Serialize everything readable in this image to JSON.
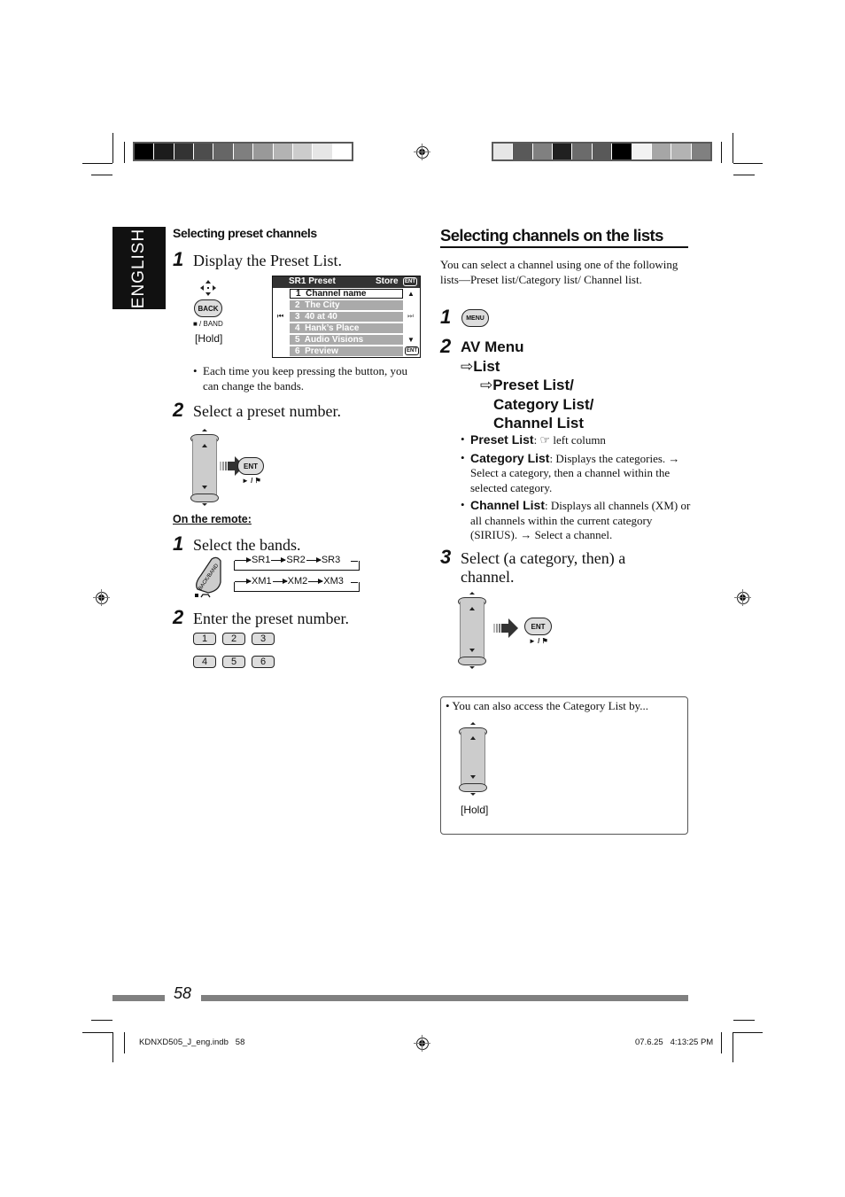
{
  "print_marks": {
    "color_bar_left": [
      "#000000",
      "#1c1c1c",
      "#333333",
      "#4d4d4d",
      "#666666",
      "#7f7f7f",
      "#999999",
      "#b3b3b3",
      "#cccccc",
      "#e6e6e6",
      "#ffffff"
    ],
    "color_bar_right": [
      "#e6e6e6",
      "#595959",
      "#808080",
      "#202020",
      "#6b6b6b",
      "#595959",
      "#000000",
      "#f2f2f2",
      "#a6a6a6",
      "#b3b3b3",
      "#808080"
    ]
  },
  "language_tab": "ENGLISH",
  "left_column": {
    "section_title": "Selecting preset channels",
    "step1": {
      "num": "1",
      "text": "Display the Preset List."
    },
    "back_button": {
      "label": "BACK",
      "caption": "■ / BAND",
      "hold": "[Hold]"
    },
    "preset_screen": {
      "header_left": "SR1 Preset",
      "header_right": "Store",
      "ent_icon": "ENT",
      "rows": [
        {
          "label": "1  Channel name",
          "selected": true
        },
        {
          "label": "2  The City",
          "selected": false
        },
        {
          "label": "3  40 at 40",
          "selected": false
        },
        {
          "label": "4  Hank’s Place",
          "selected": false
        },
        {
          "label": "5  Audio Visions",
          "selected": false
        },
        {
          "label": "6  Preview",
          "selected": false
        }
      ],
      "prev_icon": "⏮",
      "next_icon": "⏭",
      "up_icon": "▲",
      "down_icon": "▼"
    },
    "bullet1": "Each time you keep pressing the button, you can change the bands.",
    "step2": {
      "num": "2",
      "text": "Select a preset number."
    },
    "ent_button": {
      "label": "ENT",
      "caption": "► / ⚑"
    },
    "remote_heading": "On the remote:",
    "remote_step1": {
      "num": "1",
      "text": "Select the bands."
    },
    "remote_key_label": "BACK/BAND",
    "band_rows": [
      [
        "SR1",
        "SR2",
        "SR3"
      ],
      [
        "XM1",
        "XM2",
        "XM3"
      ]
    ],
    "remote_step2": {
      "num": "2",
      "text": "Enter the preset number."
    },
    "number_keys": [
      [
        "1",
        "2",
        "3"
      ],
      [
        "4",
        "5",
        "6"
      ]
    ]
  },
  "right_column": {
    "section_title": "Selecting channels on the lists",
    "intro": "You can select a channel using one of the following lists—Preset list/Category list/ Channel list.",
    "step1": {
      "num": "1",
      "button": "MENU"
    },
    "step2": {
      "num": "2",
      "line1": "AV Menu",
      "line2": "List",
      "line3": "Preset List/",
      "line4": "Category List/",
      "line5": "Channel List",
      "arrow": "⇨"
    },
    "bullets": [
      {
        "term": "Preset List",
        "text": ": ☞ left column"
      },
      {
        "term": "Category List",
        "text": ": Displays the categories. → Select a category, then a channel within the selected category."
      },
      {
        "term": "Channel List",
        "text": ": Displays all channels (XM) or all channels within the current category (SIRIUS). → Select a channel."
      }
    ],
    "step3": {
      "num": "3",
      "text": "Select (a category, then) a channel."
    },
    "ent_button": {
      "label": "ENT",
      "caption": "► / ⚑"
    },
    "note": {
      "text": "You can also access the Category List by...",
      "hold": "[Hold]"
    }
  },
  "footer": {
    "page_number": "58",
    "file_info": "KDNXD505_J_eng.indb   58",
    "timestamp": "07.6.25   4:13:25 PM"
  }
}
